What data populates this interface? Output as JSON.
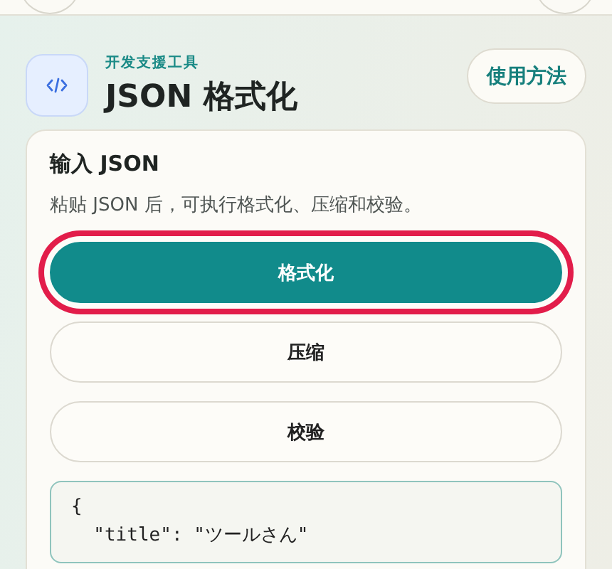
{
  "app": {
    "category": "开发支援工具",
    "title": "JSON 格式化",
    "help_button": "使用方法"
  },
  "input_card": {
    "heading": "输入 JSON",
    "description": "粘贴 JSON 后，可执行格式化、压缩和校验。",
    "actions": [
      {
        "label": "格式化",
        "kind": "primary",
        "focused": true
      },
      {
        "label": "压缩",
        "kind": "secondary",
        "focused": false
      },
      {
        "label": "校验",
        "kind": "secondary",
        "focused": false
      }
    ],
    "editor": {
      "lines": [
        "{",
        "  \"title\": \"ツールさん\""
      ]
    }
  }
}
